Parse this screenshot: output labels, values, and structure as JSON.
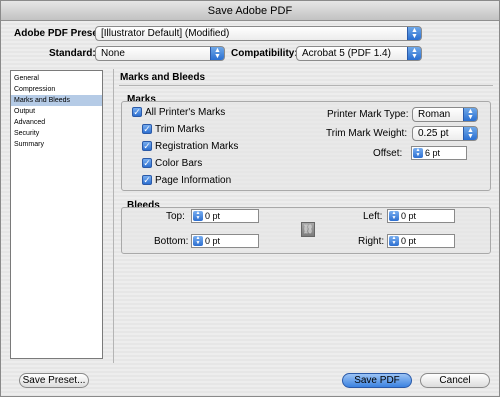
{
  "window": {
    "title": "Save Adobe PDF"
  },
  "header": {
    "preset_label": "Adobe PDF Preset:",
    "preset_value": "[Illustrator Default] (Modified)",
    "standard_label": "Standard:",
    "standard_value": "None",
    "compatibility_label": "Compatibility:",
    "compatibility_value": "Acrobat 5 (PDF 1.4)"
  },
  "sidebar": {
    "items": [
      "General",
      "Compression",
      "Marks and Bleeds",
      "Output",
      "Advanced",
      "Security",
      "Summary"
    ],
    "selected": "Marks and Bleeds"
  },
  "panel": {
    "title": "Marks and Bleeds"
  },
  "marks": {
    "group_label": "Marks",
    "all_printers_marks": "All Printer's Marks",
    "trim_marks": "Trim Marks",
    "registration_marks": "Registration Marks",
    "color_bars": "Color Bars",
    "page_information": "Page Information",
    "printer_mark_type_label": "Printer Mark Type:",
    "printer_mark_type_value": "Roman",
    "trim_mark_weight_label": "Trim Mark Weight:",
    "trim_mark_weight_value": "0.25 pt",
    "offset_label": "Offset:",
    "offset_value": "6 pt"
  },
  "bleeds": {
    "group_label": "Bleeds",
    "top_label": "Top:",
    "top_value": "0 pt",
    "bottom_label": "Bottom:",
    "bottom_value": "0 pt",
    "left_label": "Left:",
    "left_value": "0 pt",
    "right_label": "Right:",
    "right_value": "0 pt"
  },
  "footer": {
    "save_preset": "Save Preset...",
    "save_pdf": "Save PDF",
    "cancel": "Cancel"
  },
  "colors": {
    "accent": "#2d6fd0",
    "selected_row": "#b5cbe6"
  },
  "icons": {
    "popup": "up-down-arrows-icon",
    "check": "checkmark-icon",
    "link": "chain-link-icon"
  }
}
